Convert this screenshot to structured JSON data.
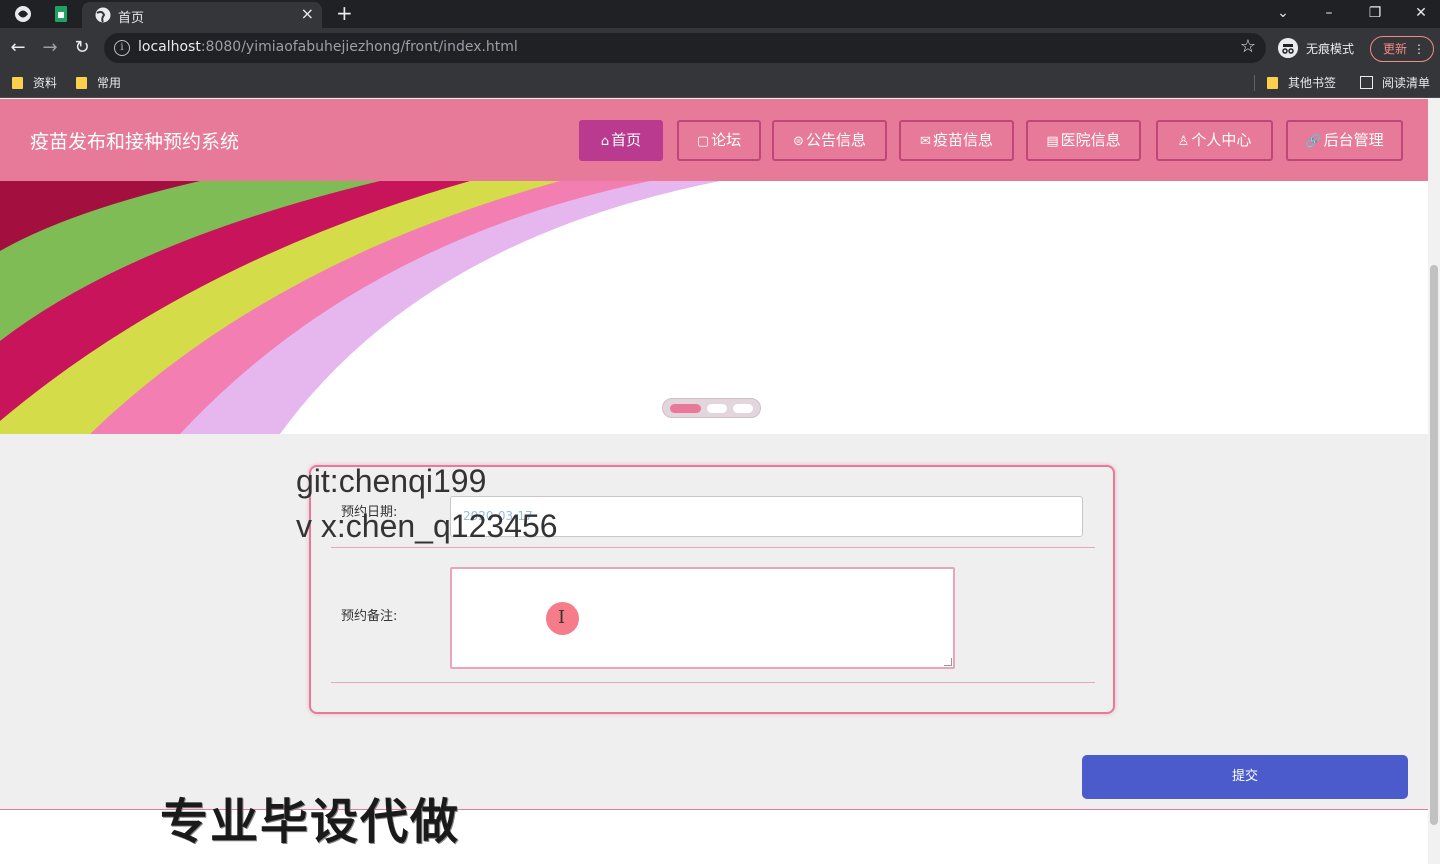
{
  "browser": {
    "tab_title": "首页",
    "new_tab": "+",
    "url_host": "localhost",
    "url_rest": ":8080/yimiaofabuhejiezhong/front/index.html",
    "incognito_label": "无痕模式",
    "update_label": "更新",
    "bookmarks": [
      "资料",
      "常用"
    ],
    "other_bookmarks": "其他书签",
    "reading_list": "阅读清单"
  },
  "site": {
    "title": "疫苗发布和接种预约系统",
    "nav": [
      {
        "label": "首页",
        "icon": "home-icon",
        "glyph": "⌂"
      },
      {
        "label": "论坛",
        "icon": "forum-icon",
        "glyph": "▢"
      },
      {
        "label": "公告信息",
        "icon": "notice-icon",
        "glyph": "⊜"
      },
      {
        "label": "疫苗信息",
        "icon": "vaccine-icon",
        "glyph": "✉"
      },
      {
        "label": "医院信息",
        "icon": "hospital-icon",
        "glyph": "▤"
      },
      {
        "label": "个人中心",
        "icon": "user-icon",
        "glyph": "♙"
      },
      {
        "label": "后台管理",
        "icon": "link-icon",
        "glyph": "🔗"
      }
    ]
  },
  "form": {
    "date_label": "预约日期:",
    "date_value": "2020-03-17",
    "note_label": "预约备注:",
    "note_value": "",
    "submit_label": "提交"
  },
  "overlay": {
    "watermark_line1": "git:chenqi199",
    "watermark_line2": "v x:chen_q123456",
    "watermark_big": "专业毕设代做"
  },
  "colors": {
    "accent": "#e77a98",
    "active_nav": "#b93a8f",
    "submit": "#4c5bcc"
  }
}
